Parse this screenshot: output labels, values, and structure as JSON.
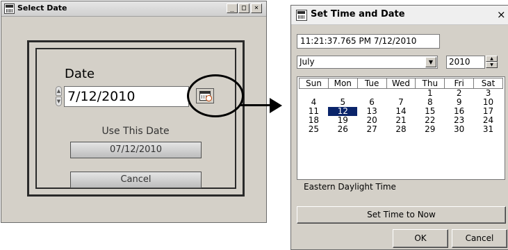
{
  "select_date_window": {
    "title": "Select Date",
    "controls": {
      "minimize": "_",
      "maximize": "□",
      "close": "×"
    },
    "date_label": "Date",
    "date_value": "7/12/2010",
    "use_label": "Use This Date",
    "date_button_label": "07/12/2010",
    "cancel_label": "Cancel"
  },
  "set_time_window": {
    "title": "Set Time and Date",
    "close": "×",
    "datetime_value": "11:21:37.765 PM 7/12/2010",
    "month": "July",
    "year": "2010",
    "weekdays": [
      "Sun",
      "Mon",
      "Tue",
      "Wed",
      "Thu",
      "Fri",
      "Sat"
    ],
    "weeks": [
      [
        "",
        "",
        "",
        "",
        "1",
        "2",
        "3"
      ],
      [
        "4",
        "5",
        "6",
        "7",
        "8",
        "9",
        "10"
      ],
      [
        "11",
        "12",
        "13",
        "14",
        "15",
        "16",
        "17"
      ],
      [
        "18",
        "19",
        "20",
        "21",
        "22",
        "23",
        "24"
      ],
      [
        "25",
        "26",
        "27",
        "28",
        "29",
        "30",
        "31"
      ]
    ],
    "selected_day": "12",
    "timezone": "Eastern Daylight Time",
    "set_now_label": "Set Time to Now",
    "ok_label": "OK",
    "cancel_label": "Cancel"
  },
  "colors": {
    "window_bg": "#d4d0c8",
    "selection": "#0a246a"
  }
}
